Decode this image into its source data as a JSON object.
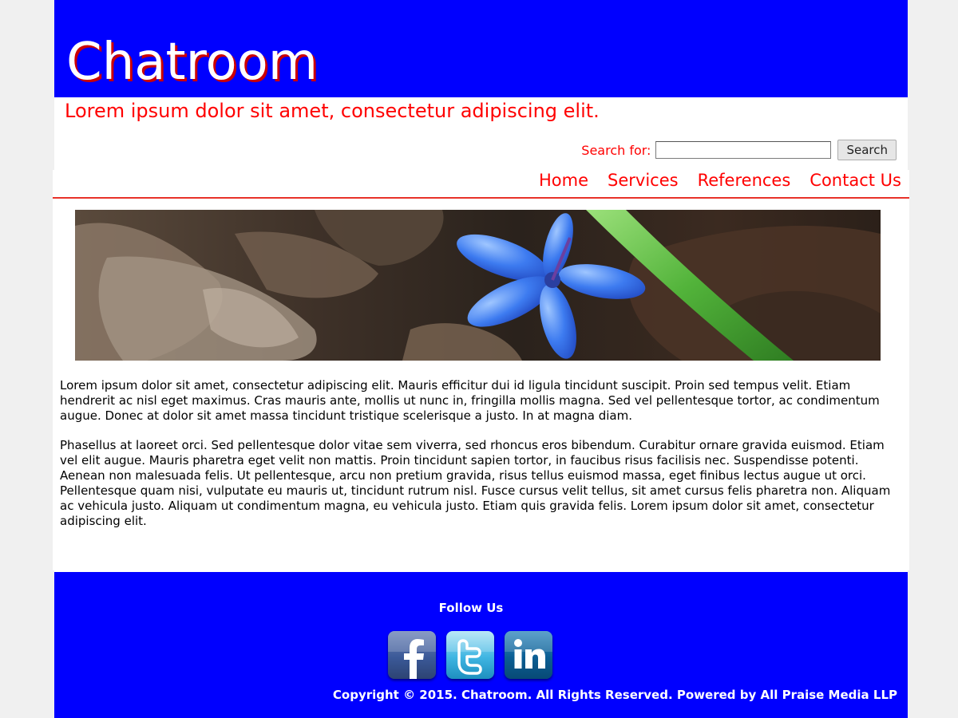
{
  "header": {
    "title": "Chatroom",
    "tagline": "Lorem ipsum dolor sit amet, consectetur adipiscing elit."
  },
  "search": {
    "label": "Search for:",
    "value": "",
    "placeholder": "",
    "button_label": "Search"
  },
  "nav": {
    "items": [
      {
        "label": "Home"
      },
      {
        "label": "Services"
      },
      {
        "label": "References"
      },
      {
        "label": "Contact Us"
      }
    ]
  },
  "main": {
    "paragraphs": [
      "Lorem ipsum dolor sit amet, consectetur adipiscing elit. Mauris efficitur dui id ligula tincidunt suscipit. Proin sed tempus velit. Etiam hendrerit ac nisl eget maximus. Cras mauris ante, mollis ut nunc in, fringilla mollis magna. Sed vel pellentesque tortor, ac condimentum augue. Donec at dolor sit amet massa tincidunt tristique scelerisque a justo. In at magna diam.",
      "Phasellus at laoreet orci. Sed pellentesque dolor vitae sem viverra, sed rhoncus eros bibendum. Curabitur ornare gravida euismod. Etiam vel elit augue. Mauris pharetra eget velit non mattis. Proin tincidunt sapien tortor, in faucibus risus facilisis nec. Suspendisse potenti. Aenean non malesuada felis. Ut pellentesque, arcu non pretium gravida, risus tellus euismod massa, eget finibus lectus augue ut orci. Pellentesque quam nisi, vulputate eu mauris ut, tincidunt rutrum nisl. Fusce cursus velit tellus, sit amet cursus felis pharetra non. Aliquam ac vehicula justo. Aliquam ut condimentum magna, eu vehicula justo. Etiam quis gravida felis. Lorem ipsum dolor sit amet, consectetur adipiscing elit."
    ]
  },
  "footer": {
    "follow_title": "Follow Us",
    "social": [
      {
        "icon": "facebook-icon"
      },
      {
        "icon": "twitter-icon"
      },
      {
        "icon": "linkedin-icon"
      }
    ],
    "copyright": "Copyright © 2015. Chatroom. All Rights Reserved. Powered by All Praise Media LLP"
  },
  "colors": {
    "brand_blue": "#0000ff",
    "accent_red": "#ff0000",
    "nav_rule": "#e8322a"
  }
}
